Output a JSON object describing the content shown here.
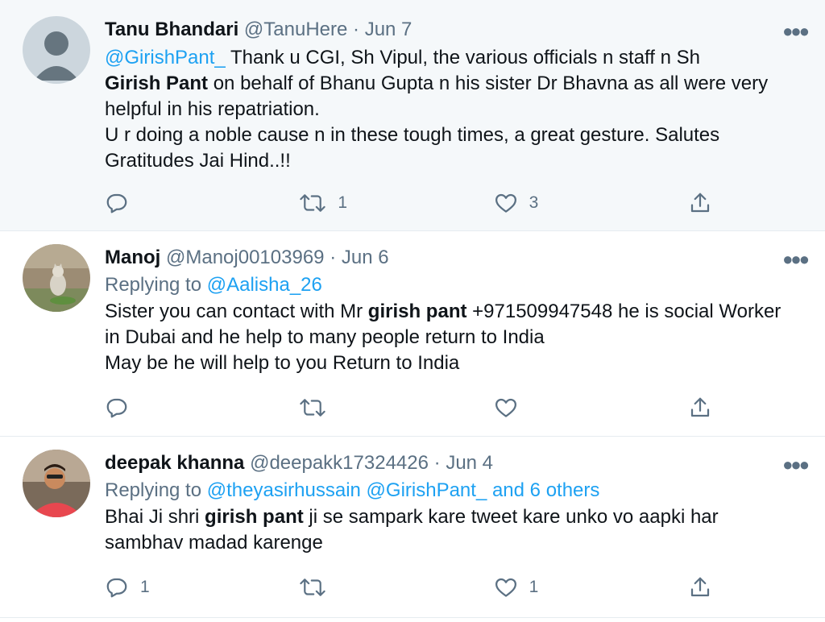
{
  "tweets": [
    {
      "name": "Tanu Bhandari",
      "handle": "@TanuHere",
      "date": "Jun 7",
      "mention": "@GirishPant_",
      "text_part1": " Thank u CGI, Sh Vipul, the various officials n staff n Sh",
      "bold": "Girish Pant",
      "text_part2": " on behalf of Bhanu Gupta n his sister Dr Bhavna as all were very helpful in his repatriation.",
      "text_part3": "U r doing a noble cause n in these tough times, a great gesture. Salutes Gratitudes Jai Hind..!!",
      "reply_count": "",
      "retweet_count": "1",
      "like_count": "3"
    },
    {
      "name": "Manoj",
      "handle": "@Manoj00103969",
      "date": "Jun 6",
      "replying_prefix": "Replying to ",
      "replying_to": "@Aalisha_26",
      "text_part1": "Sister you can contact with Mr ",
      "bold": "girish pant",
      "text_part2": " +971509947548 he is social Worker in Dubai and he help to many people return to India",
      "text_part3": "May be he will help to you Return to India",
      "reply_count": "",
      "retweet_count": "",
      "like_count": ""
    },
    {
      "name": "deepak khanna",
      "handle": "@deepakk17324426",
      "date": "Jun 4",
      "replying_prefix": "Replying to ",
      "replying_to": "@theyasirhussain @GirishPant_ and 6 others",
      "text_part1": "Bhai Ji shri ",
      "bold": "girish pant",
      "text_part2": " ji se sampark kare tweet kare unko vo aapki har sambhav madad karenge",
      "reply_count": "1",
      "retweet_count": "",
      "like_count": "1"
    }
  ],
  "separator": "·",
  "more_icon": "more-dots-icon",
  "colors": {
    "link": "#1da1f2",
    "secondary": "#5b7083",
    "highlight_bg": "#f5f8fa"
  }
}
